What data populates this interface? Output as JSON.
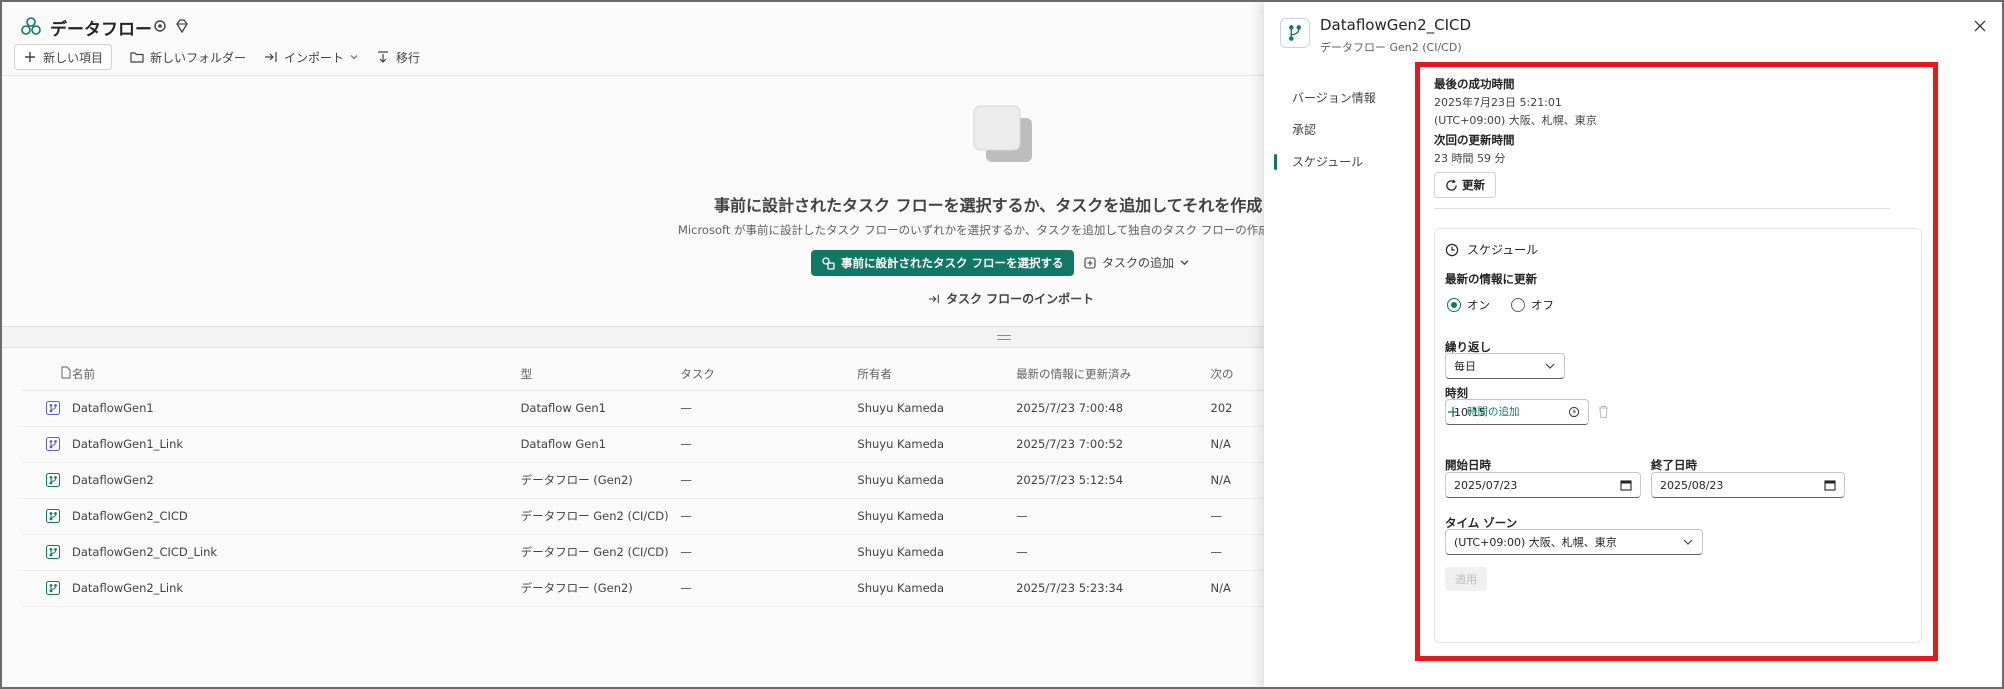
{
  "workspace": {
    "title": "データフロー",
    "toolbar": {
      "new_item": "新しい項目",
      "new_folder": "新しいフォルダー",
      "import": "インポート",
      "migrate": "移行"
    },
    "empty_state": {
      "title": "事前に設計されたタスク フローを選択するか、タスクを追加してそれを作成",
      "description": "Microsoft が事前に設計したタスク フローのいずれかを選択するか、タスクを追加して独自のタスク フローの作成を",
      "primary_button": "事前に設計されたタスク フローを選択する",
      "add_task": "タスクの追加",
      "import_task_flow": "タスク フローのインポート"
    },
    "table": {
      "columns": [
        "名前",
        "型",
        "タスク",
        "所有者",
        "最新の情報に更新済み",
        "次の"
      ],
      "rows": [
        {
          "name": "DataflowGen1",
          "type": "Dataflow Gen1",
          "task": "—",
          "owner": "Shuyu Kameda",
          "refreshed": "2025/7/23 7:00:48",
          "next": "202",
          "icon_color": "#5b5fc7"
        },
        {
          "name": "DataflowGen1_Link",
          "type": "Dataflow Gen1",
          "task": "—",
          "owner": "Shuyu Kameda",
          "refreshed": "2025/7/23 7:00:52",
          "next": "N/A",
          "icon_color": "#5b5fc7"
        },
        {
          "name": "DataflowGen2",
          "type": "データフロー (Gen2)",
          "task": "—",
          "owner": "Shuyu Kameda",
          "refreshed": "2025/7/23 5:12:54",
          "next": "N/A",
          "icon_color": "#117865"
        },
        {
          "name": "DataflowGen2_CICD",
          "type": "データフロー Gen2 (CI/CD)",
          "task": "—",
          "owner": "Shuyu Kameda",
          "refreshed": "—",
          "next": "—",
          "icon_color": "#117865"
        },
        {
          "name": "DataflowGen2_CICD_Link",
          "type": "データフロー Gen2 (CI/CD)",
          "task": "—",
          "owner": "Shuyu Kameda",
          "refreshed": "—",
          "next": "—",
          "icon_color": "#117865"
        },
        {
          "name": "DataflowGen2_Link",
          "type": "データフロー (Gen2)",
          "task": "—",
          "owner": "Shuyu Kameda",
          "refreshed": "2025/7/23 5:23:34",
          "next": "N/A",
          "icon_color": "#117865"
        }
      ]
    }
  },
  "panel": {
    "title": "DataflowGen2_CICD",
    "subtitle": "データフロー Gen2 (CI/CD)",
    "nav": [
      "バージョン情報",
      "承認",
      "スケジュール"
    ],
    "last_success_label": "最後の成功時間",
    "last_success_date": "2025年7月23日 5:21:01",
    "last_success_tz": "(UTC+09:00) 大阪、札幌、東京",
    "next_refresh_label": "次回の更新時間",
    "next_refresh_value": "23 時間 59 分",
    "refresh_button": "更新",
    "schedule": {
      "heading": "スケジュール",
      "refresh_label": "最新の情報に更新",
      "on": "オン",
      "off": "オフ",
      "repeat_label": "繰り返し",
      "repeat_value": "毎日",
      "time_label": "時刻",
      "time_value": "10:15",
      "add_time": "時間の追加",
      "start_label": "開始日時",
      "start_value": "2025/07/23",
      "end_label": "終了日時",
      "end_value": "2025/08/23",
      "tz_label": "タイム ゾーン",
      "tz_value": "(UTC+09:00) 大阪、札幌、東京",
      "apply": "適用"
    }
  },
  "colors": {
    "accent": "#117865",
    "highlight_border": "#e8171a"
  }
}
